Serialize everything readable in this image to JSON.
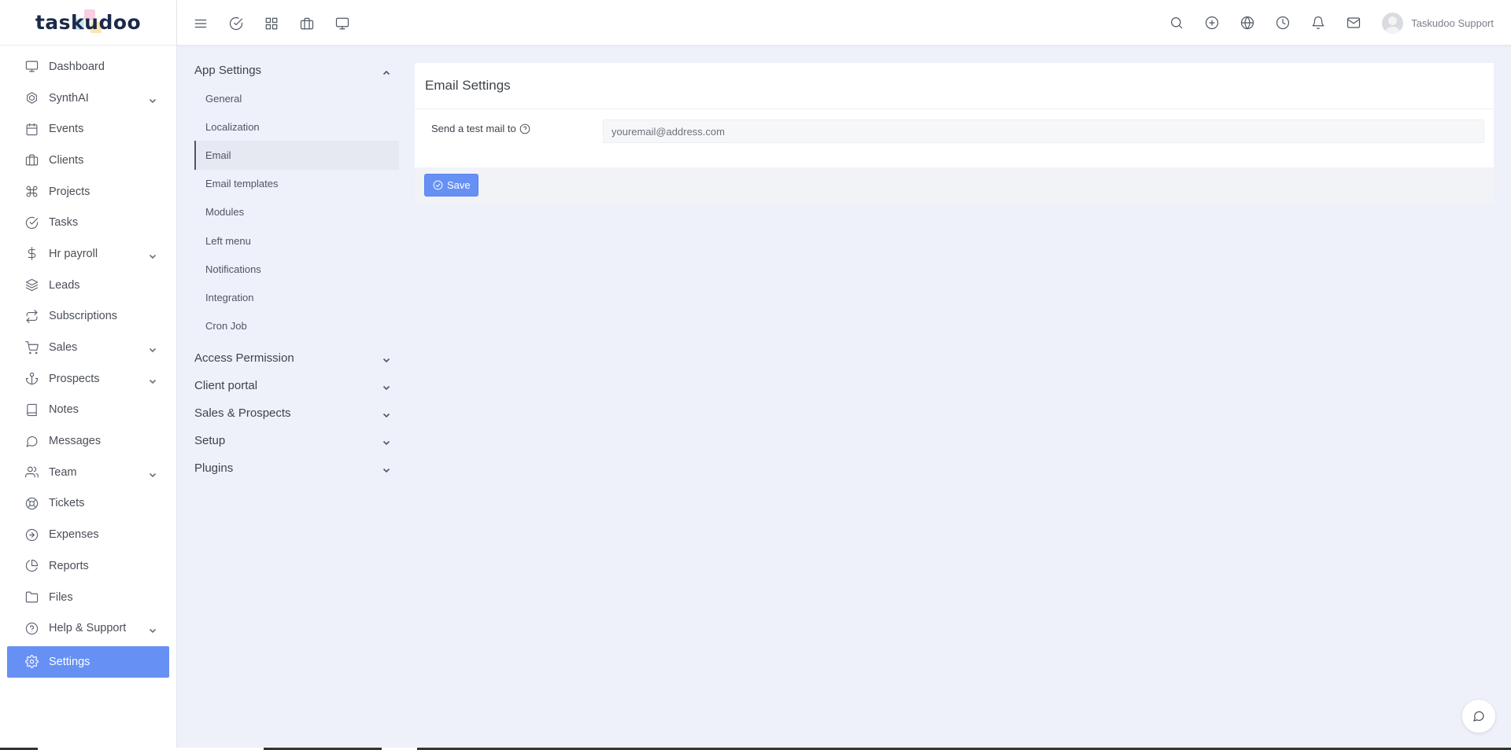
{
  "brand": {
    "logo_text": "taskudoo"
  },
  "colors": {
    "accent": "#6690f4",
    "background": "#eef1f9",
    "text": "#4a4f57"
  },
  "sidebar": {
    "items": [
      {
        "label": "Dashboard",
        "icon": "monitor-icon",
        "has_chevron": false
      },
      {
        "label": "SynthAI",
        "icon": "openai-icon",
        "has_chevron": true
      },
      {
        "label": "Events",
        "icon": "calendar-icon",
        "has_chevron": false
      },
      {
        "label": "Clients",
        "icon": "briefcase-icon",
        "has_chevron": false
      },
      {
        "label": "Projects",
        "icon": "command-icon",
        "has_chevron": false
      },
      {
        "label": "Tasks",
        "icon": "check-circle-icon",
        "has_chevron": false
      },
      {
        "label": "Hr payroll",
        "icon": "dollar-icon",
        "has_chevron": true
      },
      {
        "label": "Leads",
        "icon": "layers-icon",
        "has_chevron": false
      },
      {
        "label": "Subscriptions",
        "icon": "repeat-icon",
        "has_chevron": false
      },
      {
        "label": "Sales",
        "icon": "cart-icon",
        "has_chevron": true
      },
      {
        "label": "Prospects",
        "icon": "anchor-icon",
        "has_chevron": true
      },
      {
        "label": "Notes",
        "icon": "book-icon",
        "has_chevron": false
      },
      {
        "label": "Messages",
        "icon": "message-circle-icon",
        "has_chevron": false
      },
      {
        "label": "Team",
        "icon": "users-icon",
        "has_chevron": true
      },
      {
        "label": "Tickets",
        "icon": "life-buoy-icon",
        "has_chevron": false
      },
      {
        "label": "Expenses",
        "icon": "arrow-circle-icon",
        "has_chevron": false
      },
      {
        "label": "Reports",
        "icon": "pie-chart-icon",
        "has_chevron": false
      },
      {
        "label": "Files",
        "icon": "folder-icon",
        "has_chevron": false
      },
      {
        "label": "Help & Support",
        "icon": "help-circle-icon",
        "has_chevron": true
      },
      {
        "label": "Settings",
        "icon": "gear-icon",
        "has_chevron": false,
        "active": true
      }
    ]
  },
  "topbar": {
    "left_icons": [
      "menu-icon",
      "check-circle-icon",
      "grid-icon",
      "briefcase-icon",
      "monitor-icon"
    ],
    "right_icons": [
      "search-icon",
      "plus-circle-icon",
      "globe-icon",
      "clock-icon",
      "bell-icon",
      "mail-icon"
    ],
    "user_name": "Taskudoo Support"
  },
  "settings_nav": {
    "sections": [
      {
        "title": "App Settings",
        "expanded": true,
        "items": [
          "General",
          "Localization",
          "Email",
          "Email templates",
          "Modules",
          "Left menu",
          "Notifications",
          "Integration",
          "Cron Job"
        ],
        "active_item": "Email"
      },
      {
        "title": "Access Permission",
        "expanded": false
      },
      {
        "title": "Client portal",
        "expanded": false
      },
      {
        "title": "Sales & Prospects",
        "expanded": false
      },
      {
        "title": "Setup",
        "expanded": false
      },
      {
        "title": "Plugins",
        "expanded": false
      }
    ]
  },
  "main": {
    "title": "Email Settings",
    "field_label": "Send a test mail to",
    "field_value": "",
    "field_placeholder": "youremail@address.com",
    "save_label": "Save"
  }
}
